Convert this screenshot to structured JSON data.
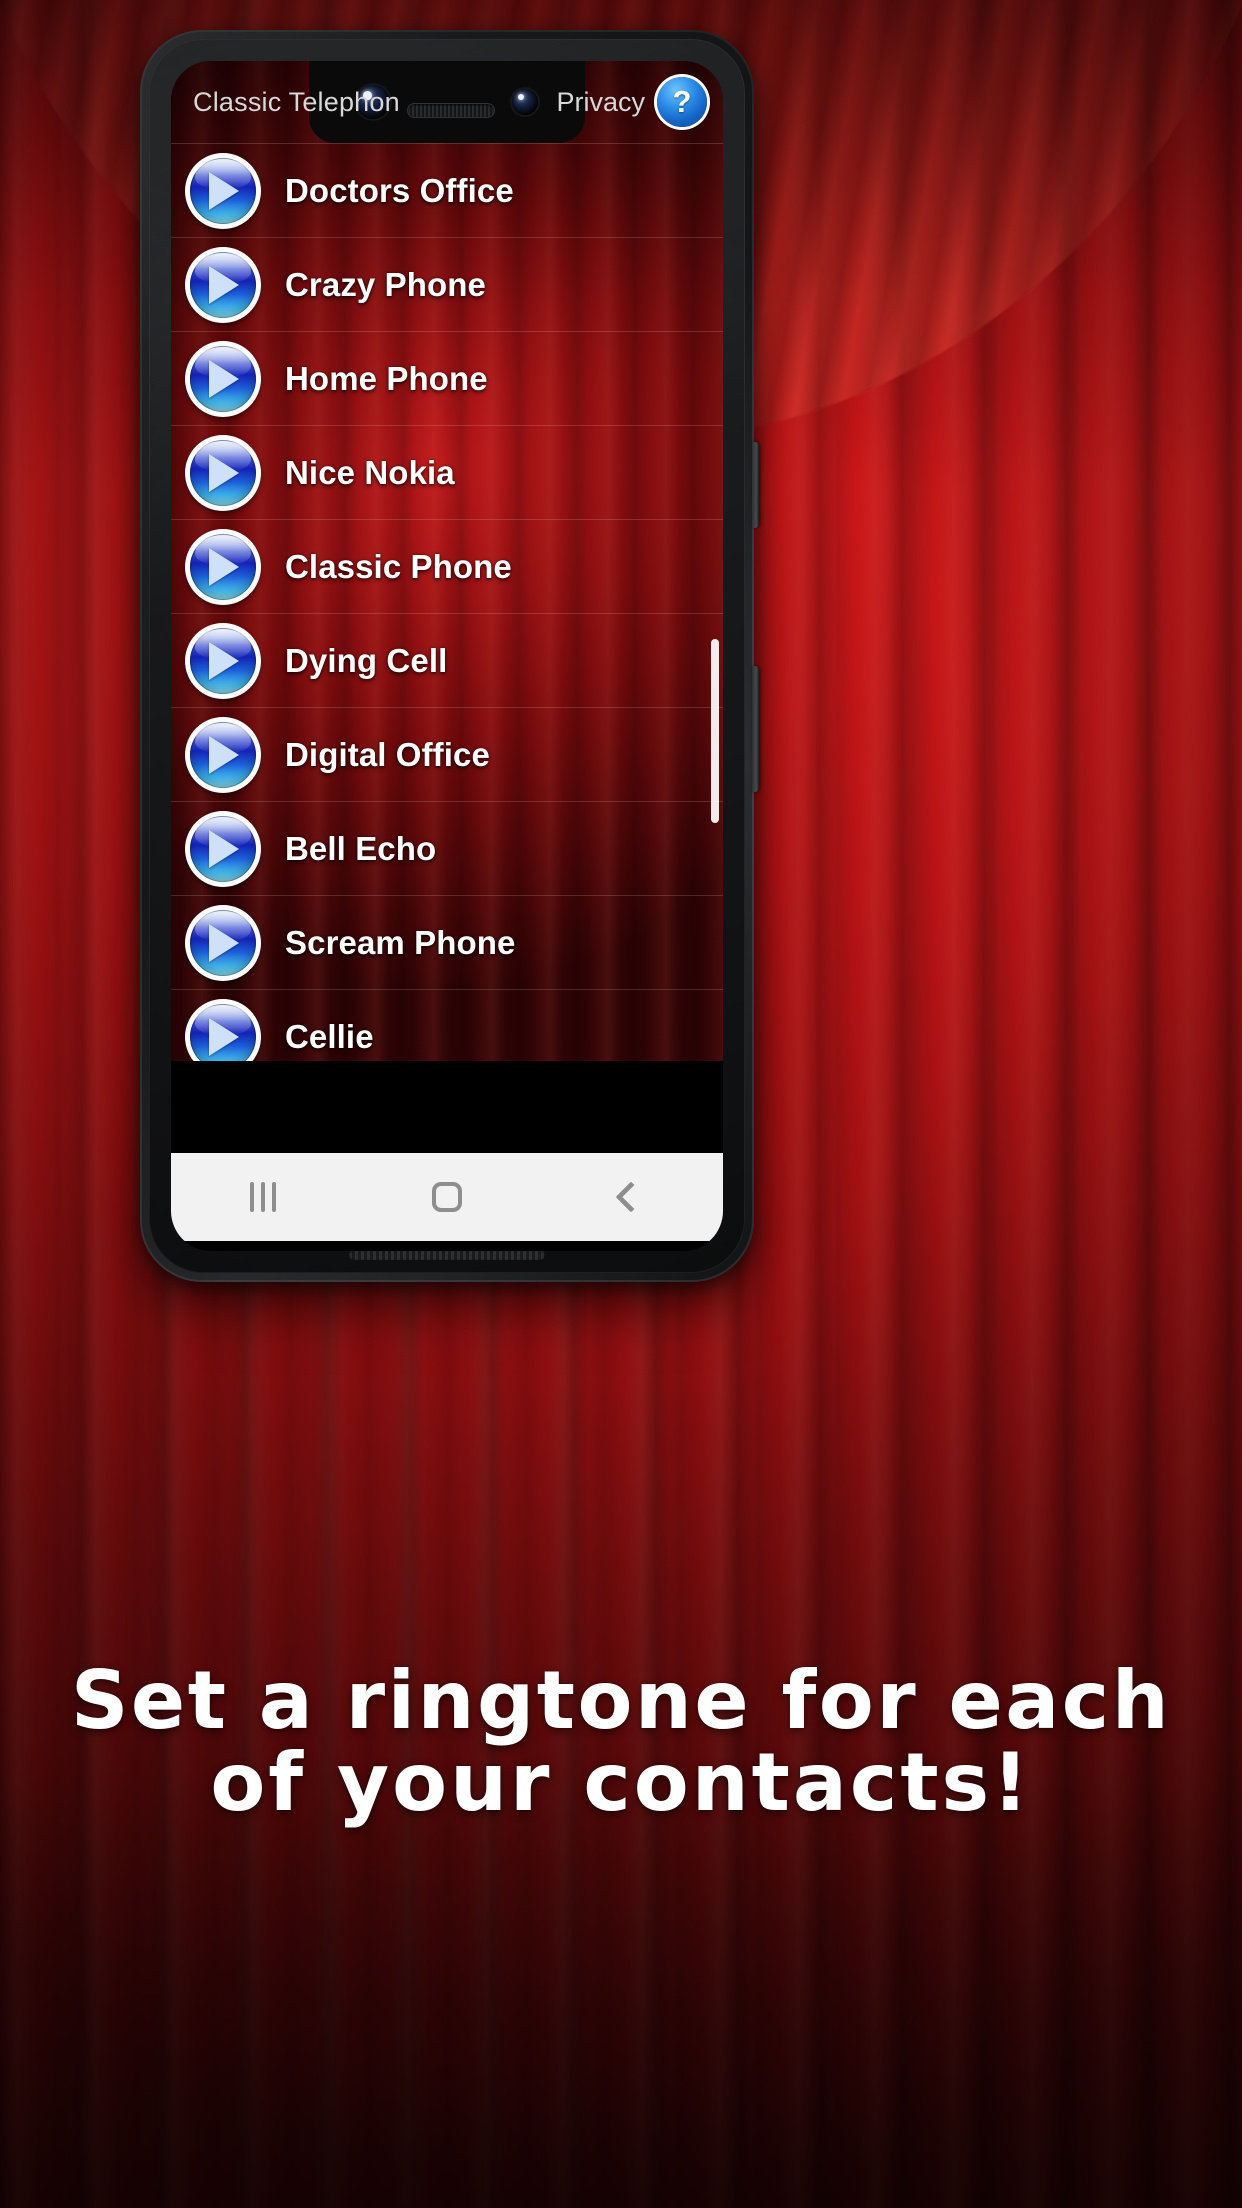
{
  "app": {
    "header": {
      "title": "Classic Telephon",
      "privacy_label": "Privacy",
      "help_icon_glyph": "?",
      "help_icon_name": "question-mark-help-icon"
    },
    "ringtones": [
      {
        "name": "Doctors Office",
        "play_icon": "play-icon"
      },
      {
        "name": "Crazy Phone",
        "play_icon": "play-icon"
      },
      {
        "name": "Home Phone",
        "play_icon": "play-icon"
      },
      {
        "name": "Nice Nokia",
        "play_icon": "play-icon"
      },
      {
        "name": "Classic Phone",
        "play_icon": "play-icon"
      },
      {
        "name": "Dying Cell",
        "play_icon": "play-icon"
      },
      {
        "name": "Digital Office",
        "play_icon": "play-icon"
      },
      {
        "name": "Bell Echo",
        "play_icon": "play-icon"
      },
      {
        "name": "Scream Phone",
        "play_icon": "play-icon"
      },
      {
        "name": "Cellie",
        "play_icon": "play-icon"
      }
    ]
  },
  "device": {
    "nav_bar": {
      "recents_icon": "recents-icon",
      "home_icon": "home-icon",
      "back_icon": "back-chevron-icon"
    },
    "notch": {
      "camera_left_icon": "front-camera-icon",
      "camera_right_icon": "front-camera-secondary-icon",
      "earpiece_icon": "earpiece-speaker-icon"
    }
  },
  "caption": {
    "line1": "Set a ringtone for each",
    "line2": "of your contacts!"
  },
  "colors": {
    "curtain_red": "#a81215",
    "curtain_dark": "#2a0204",
    "play_button_blue": "#1423b8",
    "play_button_cyan": "#3fb6ef",
    "help_blue": "#1464c4",
    "caption_white": "#ffffff",
    "header_text": "#d8d8d8",
    "nav_bar_bg": "#f2f2f2",
    "nav_icon_gray": "#8e8e8e"
  }
}
